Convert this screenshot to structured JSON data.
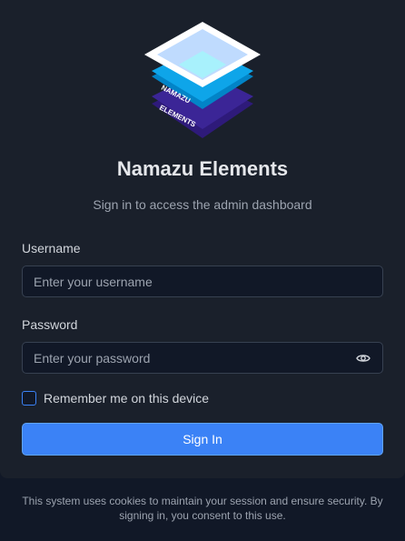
{
  "app": {
    "title": "Namazu Elements",
    "subtitle": "Sign in to access the admin dashboard",
    "logo": {
      "text_top": "NAMAZU",
      "text_bottom": "ELEMENTS"
    }
  },
  "form": {
    "username": {
      "label": "Username",
      "value": "",
      "placeholder": "Enter your username"
    },
    "password": {
      "label": "Password",
      "value": "",
      "placeholder": "Enter your password",
      "toggle_icon": "eye-icon"
    },
    "remember": {
      "label": "Remember me on this device",
      "checked": false
    },
    "submit_label": "Sign In"
  },
  "footer": {
    "notice": "This system uses cookies to maintain your session and ensure security. By signing in, you consent to this use."
  },
  "colors": {
    "background": "#111827",
    "card": "#1a202b",
    "accent": "#3b82f6",
    "logo_cyan": "#0ea5e9",
    "logo_purple": "#3b1f8c"
  }
}
